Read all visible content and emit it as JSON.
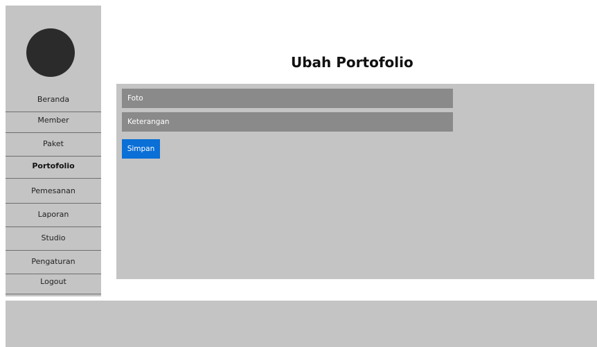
{
  "sidebar": {
    "items": [
      {
        "label": "Beranda",
        "active": false
      },
      {
        "label": "Member",
        "active": false
      },
      {
        "label": "Paket",
        "active": false
      },
      {
        "label": "Portofolio",
        "active": true
      },
      {
        "label": "Pemesanan",
        "active": false
      },
      {
        "label": "Laporan",
        "active": false
      },
      {
        "label": "Studio",
        "active": false
      },
      {
        "label": "Pengaturan",
        "active": false
      },
      {
        "label": "Logout",
        "active": false
      }
    ]
  },
  "main": {
    "title": "Ubah Portofolio",
    "form": {
      "photo_placeholder": "Foto",
      "description_placeholder": "Keterangan",
      "save_label": "Simpan"
    }
  },
  "colors": {
    "sidebar_bg": "#c4c4c4",
    "panel_bg": "#c4c4c4",
    "field_bg": "#8a8a8a",
    "avatar": "#2b2b2b",
    "button": "#0a6fd6"
  }
}
